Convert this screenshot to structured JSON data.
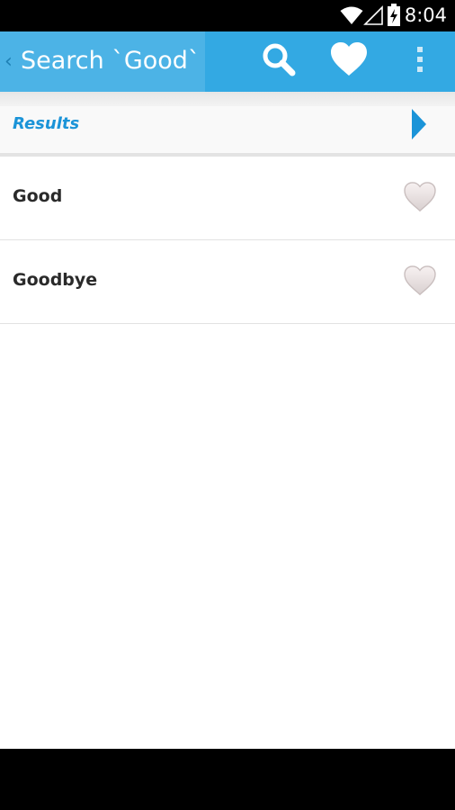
{
  "status_bar": {
    "time": "8:04",
    "icons": [
      "wifi-icon",
      "signal-icon",
      "battery-charging-icon"
    ]
  },
  "action_bar": {
    "back_glyph": "‹",
    "title": "Search `Good`",
    "actions": [
      "search-icon",
      "heart-icon",
      "overflow-menu-icon"
    ],
    "colors": {
      "bar": "#33a9e3",
      "up_area": "#4cb3e6"
    }
  },
  "results": {
    "header_label": "Results",
    "header_color": "#1b94d8",
    "items": [
      {
        "word": "Good",
        "favorite_icon": "heart-outline-icon"
      },
      {
        "word": "Goodbye",
        "favorite_icon": "heart-outline-icon"
      }
    ]
  }
}
